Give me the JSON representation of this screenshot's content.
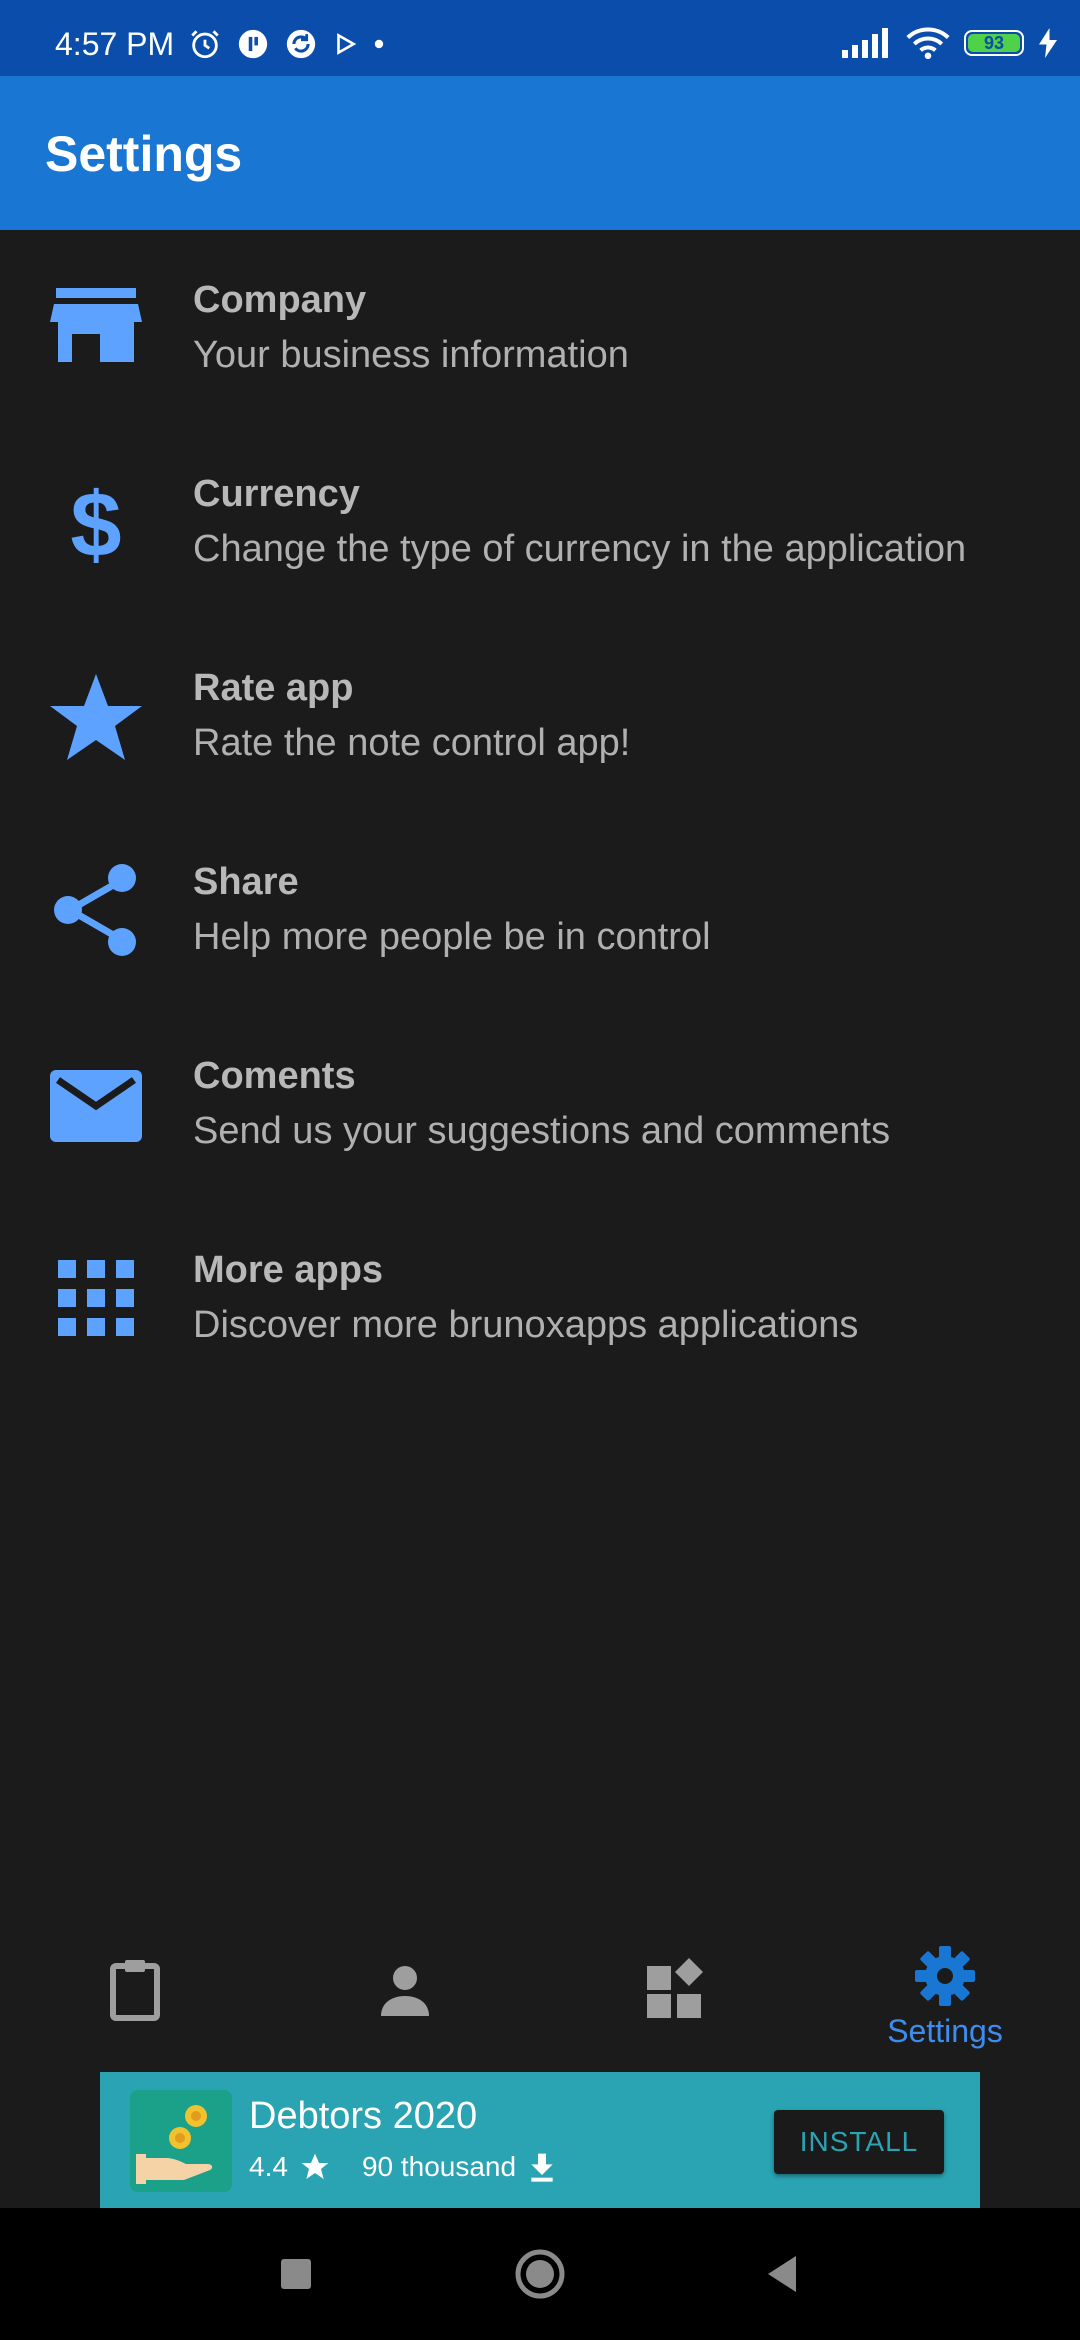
{
  "status_bar": {
    "time": "4:57 PM",
    "battery_level": "93",
    "icons": [
      "alarm-icon",
      "app-notification-icon",
      "sync-icon",
      "play-icon",
      "dot-icon",
      "signal-icon",
      "wifi-icon",
      "battery-icon",
      "charging-icon"
    ]
  },
  "app_bar": {
    "title": "Settings"
  },
  "settings": {
    "items": [
      {
        "icon": "store-icon",
        "title": "Company",
        "subtitle": "Your business information"
      },
      {
        "icon": "dollar-icon",
        "title": "Currency",
        "subtitle": "Change the type of currency in the application"
      },
      {
        "icon": "star-icon",
        "title": "Rate app",
        "subtitle": "Rate the note control app!"
      },
      {
        "icon": "share-icon",
        "title": "Share",
        "subtitle": "Help more people be in control"
      },
      {
        "icon": "mail-icon",
        "title": "Coments",
        "subtitle": "Send us your suggestions and comments"
      },
      {
        "icon": "apps-grid-icon",
        "title": "More apps",
        "subtitle": "Discover more brunoxapps applications"
      }
    ]
  },
  "bottom_nav": {
    "items": [
      {
        "icon": "clipboard-icon",
        "label": ""
      },
      {
        "icon": "person-icon",
        "label": ""
      },
      {
        "icon": "widgets-icon",
        "label": ""
      },
      {
        "icon": "gear-icon",
        "label": "Settings",
        "active": true
      }
    ]
  },
  "ad": {
    "app_name": "Debtors 2020",
    "rating": "4.4",
    "downloads": "90 thousand",
    "install_label": "INSTALL"
  },
  "colors": {
    "status_bar": "#0b4dab",
    "app_bar": "#1976d2",
    "background": "#1b1b1b",
    "accent": "#5ea2ff",
    "ad_background": "#2aa3b3"
  }
}
